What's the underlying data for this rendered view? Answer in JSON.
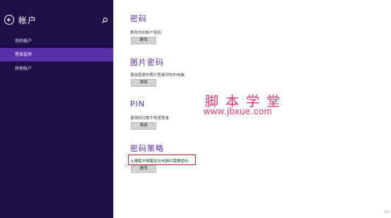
{
  "sidebar": {
    "title": "帐户",
    "items": [
      {
        "label": "你的帐户"
      },
      {
        "label": "登录选项"
      },
      {
        "label": "其他帐户"
      }
    ]
  },
  "sections": {
    "password": {
      "title": "密码",
      "desc": "更改你的帐户密码",
      "button": "更改"
    },
    "picture_password": {
      "title": "图片密码",
      "desc": "使用喜爱的照片登录到你的电脑",
      "button": "添加"
    },
    "pin": {
      "title": "PIN",
      "desc": "使用四位数字快速登录",
      "button": "添加"
    },
    "password_policy": {
      "title": "密码策略",
      "desc": "从睡眠中唤醒这台电脑时需要密码",
      "button": "更改"
    }
  },
  "watermark": {
    "text": "脚本学堂",
    "url": "www.jbxue.com"
  },
  "page_marker": "·43",
  "colors": {
    "sidebar_bg": "#1e0f47",
    "selected_bg": "#5b2fa6",
    "accent": "#5b2fa6",
    "highlight": "#b32222",
    "watermark": "#e3326e"
  }
}
